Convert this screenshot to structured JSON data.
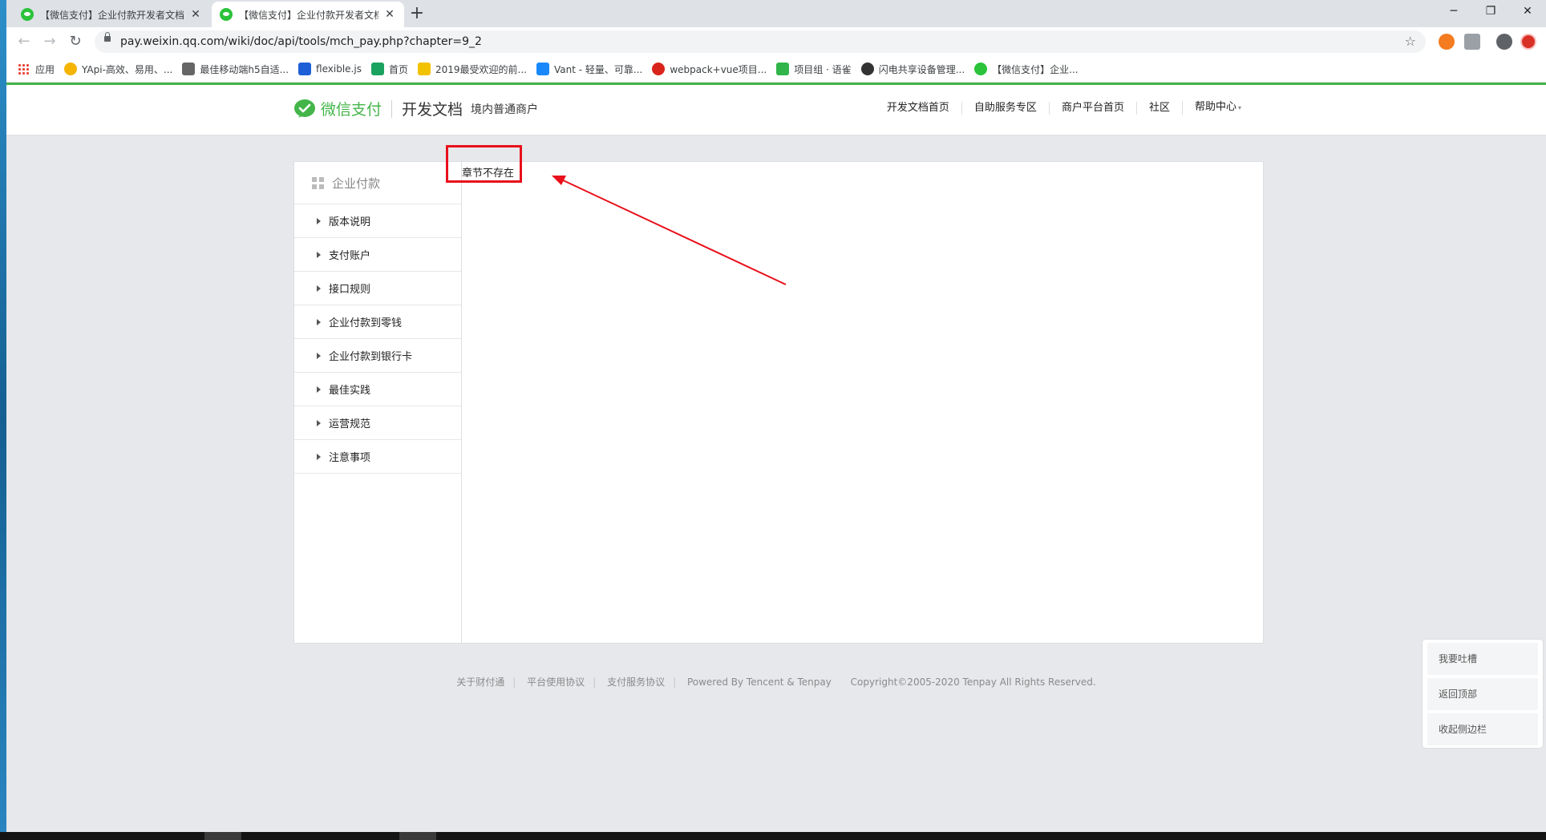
{
  "tabs": [
    {
      "title": "【微信支付】企业付款开发者文档",
      "close": "✕"
    },
    {
      "title": "【微信支付】企业付款开发者文档",
      "close": "✕"
    }
  ],
  "new_tab": "+",
  "window_controls": {
    "minimize": "─",
    "maximize": "❐",
    "close": "✕"
  },
  "toolbar": {
    "back": "←",
    "forward": "→",
    "reload": "↻",
    "url": "pay.weixin.qq.com/wiki/doc/api/tools/mch_pay.php?chapter=9_2",
    "star": "☆"
  },
  "bookmarks": [
    {
      "label": "应用",
      "color": "#e94335"
    },
    {
      "label": "YApi-高效、易用、...",
      "color": "#f4b400"
    },
    {
      "label": "最佳移动端h5自适...",
      "color": "#666666"
    },
    {
      "label": "flexible.js",
      "color": "#1e5ed7"
    },
    {
      "label": "首页",
      "color": "#1aa260"
    },
    {
      "label": "2019最受欢迎的前...",
      "color": "#f2c200"
    },
    {
      "label": "Vant - 轻量、可靠...",
      "color": "#1989fa"
    },
    {
      "label": "webpack+vue项目...",
      "color": "#d9241b"
    },
    {
      "label": "项目组 · 语雀",
      "color": "#31b54a"
    },
    {
      "label": "闪电共享设备管理...",
      "color": "#333333"
    },
    {
      "label": "【微信支付】企业...",
      "color": "#2ac33a"
    }
  ],
  "header": {
    "brand": "微信支付",
    "section": "开发文档",
    "subsection": "境内普通商户",
    "nav": [
      "开发文档首页",
      "自助服务专区",
      "商户平台首页",
      "社区",
      "帮助中心"
    ],
    "nav_caret": "▾"
  },
  "sidebar": {
    "title": "企业付款",
    "items": [
      "版本说明",
      "支付账户",
      "接口规则",
      "企业付款到零钱",
      "企业付款到银行卡",
      "最佳实践",
      "运营规范",
      "注意事项"
    ]
  },
  "main": {
    "message": "章节不存在"
  },
  "footer": {
    "links": [
      "关于财付通",
      "平台使用协议",
      "支付服务协议"
    ],
    "powered": "Powered By Tencent & Tenpay",
    "copyright": "Copyright©2005-2020 Tenpay All Rights Reserved."
  },
  "float_panel": [
    "我要吐槽",
    "返回顶部",
    "收起侧边栏"
  ],
  "colors": {
    "brand_green": "#44b549",
    "annotation_red": "#e8101b"
  }
}
